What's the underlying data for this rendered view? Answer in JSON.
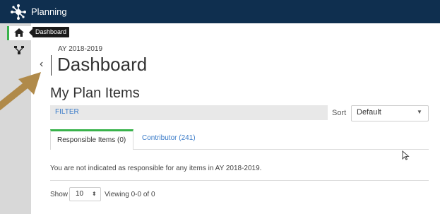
{
  "app": {
    "title": "Planning",
    "logo_icon": "network-hub-icon",
    "brand_color": "#0f2f4f",
    "accent_color": "#38b24a"
  },
  "sidebar": {
    "items": [
      {
        "icon": "home-icon",
        "tooltip": "Dashboard",
        "active": true
      },
      {
        "icon": "hierarchy-icon",
        "active": false
      }
    ]
  },
  "page": {
    "academic_year": "AY 2018-2019",
    "title": "Dashboard",
    "collapse_glyph": "‹"
  },
  "plan_items": {
    "heading": "My Plan Items",
    "filter_label": "FILTER",
    "sort_label": "Sort",
    "sort_value": "Default",
    "tabs": [
      {
        "label": "Responsible Items (0)",
        "active": true
      },
      {
        "label": "Contributor (241)",
        "active": false
      }
    ],
    "empty_message": "You are not indicated as responsible for any items in AY 2018-2019.",
    "show_label": "Show",
    "page_size": "10",
    "viewing_text": "Viewing 0-0 of 0"
  }
}
